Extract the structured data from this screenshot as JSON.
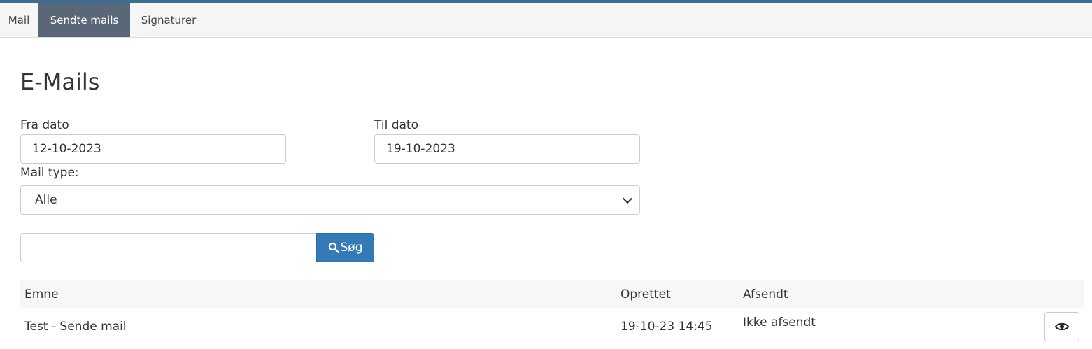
{
  "nav": {
    "tabs": [
      {
        "label": "Mail",
        "active": false
      },
      {
        "label": "Sendte mails",
        "active": true
      },
      {
        "label": "Signaturer",
        "active": false
      }
    ]
  },
  "page": {
    "title": "E-Mails"
  },
  "filters": {
    "from_label": "Fra dato",
    "from_value": "12-10-2023",
    "to_label": "Til dato",
    "to_value": "19-10-2023",
    "type_label": "Mail type:",
    "type_value": "Alle"
  },
  "search": {
    "value": "",
    "button_label": "Søg",
    "icon": "search-icon"
  },
  "table": {
    "headers": [
      "Emne",
      "Oprettet",
      "Afsendt"
    ],
    "rows": [
      {
        "subject": "Test - Sende mail",
        "created": "19-10-23 14:45",
        "sent": "Ikke afsendt",
        "action_icon": "eye-icon"
      }
    ]
  },
  "colors": {
    "accent": "#3c6e8f",
    "active_tab": "#5a6778",
    "primary_button": "#337ab7"
  }
}
